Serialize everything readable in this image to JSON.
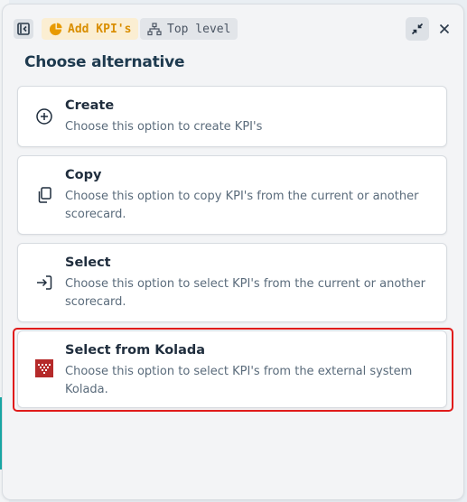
{
  "header": {
    "chip_kpi_label": "Add KPI's",
    "chip_top_label": "Top level",
    "accent": "#d98e00"
  },
  "title": "Choose alternative",
  "options": [
    {
      "icon": "plus-circle-icon",
      "title": "Create",
      "desc": "Choose this option to create KPI's"
    },
    {
      "icon": "copy-icon",
      "title": "Copy",
      "desc": "Choose this option to copy KPI's from the current or another scorecard."
    },
    {
      "icon": "sign-in-icon",
      "title": "Select",
      "desc": "Choose this option to select KPI's from the current or another scorecard."
    },
    {
      "icon": "kolada-logo-icon",
      "title": "Select from Kolada",
      "desc": "Choose this option to select KPI's from the external system Kolada."
    }
  ],
  "highlight_color": "#e01b1b"
}
